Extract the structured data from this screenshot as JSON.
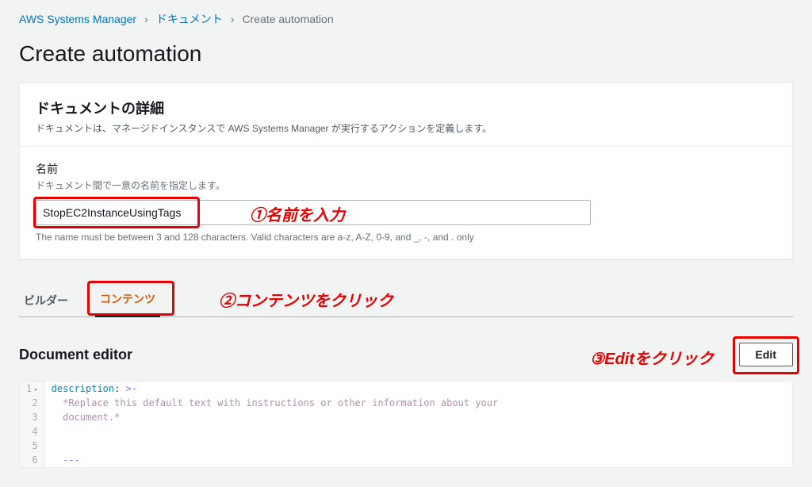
{
  "breadcrumb": {
    "root": "AWS Systems Manager",
    "mid": "ドキュメント",
    "current": "Create automation"
  },
  "page_title": "Create automation",
  "details": {
    "title": "ドキュメントの詳細",
    "desc": "ドキュメントは、マネージドインスタンスで AWS Systems Manager が実行するアクションを定義します。",
    "name_label": "名前",
    "name_hint": "ドキュメント間で一意の名前を指定します。",
    "name_value": "StopEC2InstanceUsingTags",
    "name_rule": "The name must be between 3 and 128 characters. Valid characters are a-z, A-Z, 0-9, and _, -, and . only"
  },
  "tabs": {
    "builder": "ビルダー",
    "contents": "コンテンツ"
  },
  "editor": {
    "title": "Document editor",
    "edit_btn": "Edit",
    "code": {
      "l1_key": "description",
      "l1_op": ": ",
      "l1_sym": ">-",
      "l2": "  *Replace this default text with instructions or other information about your",
      "l3": "  document.*",
      "l4": "",
      "l5": "",
      "l6": "  ---"
    }
  },
  "annotations": {
    "a1": "①名前を入力",
    "a2": "②コンテンツをクリック",
    "a3": "③Editをクリック"
  }
}
